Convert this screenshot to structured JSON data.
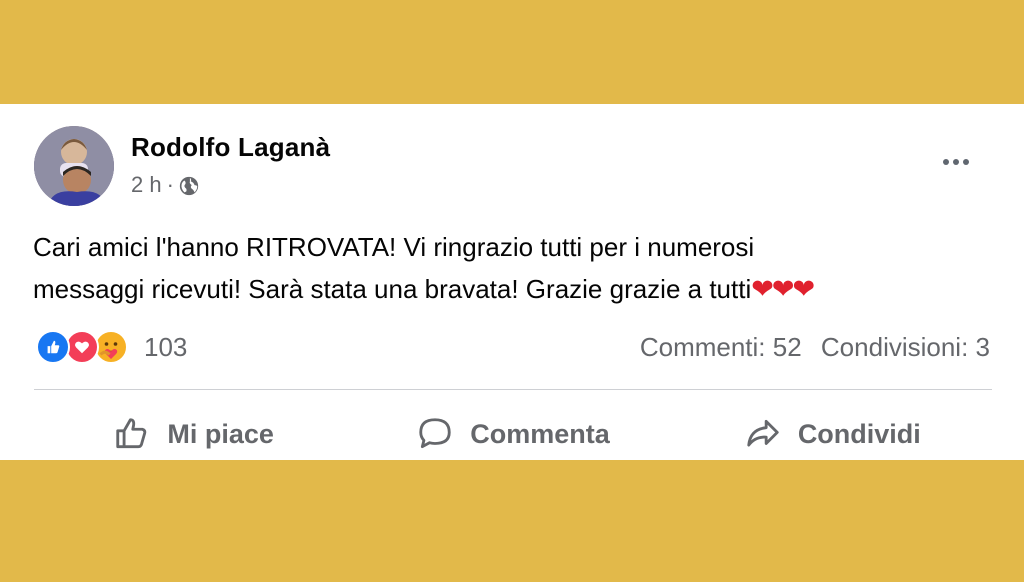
{
  "post": {
    "author": "Rodolfo Laganà",
    "time": "2 h",
    "separator": "·",
    "audience_icon": "globe-icon",
    "text_line_1": "Cari amici l'hanno RITROVATA! Vi ringrazio tutti per i numerosi",
    "text_line_2": "messaggi ricevuti! Sarà stata una bravata! Grazie grazie a tutti",
    "text_hearts": "❤❤❤"
  },
  "reactions": {
    "icons": [
      "like-icon",
      "love-icon",
      "care-icon"
    ],
    "count": "103"
  },
  "stats": {
    "comments": "Commenti: 52",
    "shares": "Condivisioni: 3"
  },
  "actions": {
    "like": "Mi piace",
    "comment": "Commenta",
    "share": "Condividi"
  },
  "colors": {
    "background": "#e2b94a",
    "card": "#ffffff",
    "muted_text": "#65676b",
    "like_blue": "#1877f2",
    "love_red": "#f33e58",
    "care_yellow": "#f7b125"
  }
}
